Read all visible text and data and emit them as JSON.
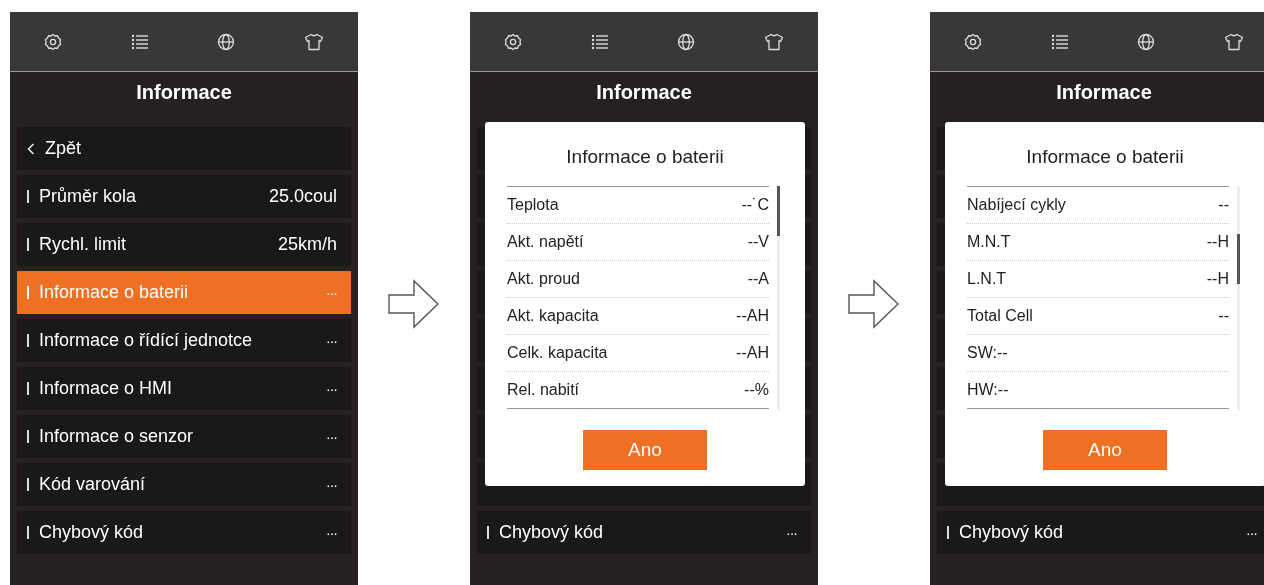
{
  "screens": [
    {
      "title": "Informace",
      "back": "Zpět",
      "items": [
        {
          "label": "Průměr kola",
          "value": "25.0coul",
          "selected": false
        },
        {
          "label": "Rychl. limit",
          "value": "25km/h",
          "selected": false
        },
        {
          "label": "Informace o baterii",
          "value": "···",
          "selected": true
        },
        {
          "label": "Informace o řídící jednotce",
          "value": "···",
          "selected": false
        },
        {
          "label": "Informace o HMI",
          "value": "···",
          "selected": false
        },
        {
          "label": "Informace o senzor",
          "value": "···",
          "selected": false
        },
        {
          "label": "Kód varování",
          "value": "···",
          "selected": false
        },
        {
          "label": "Chybový kód",
          "value": "···",
          "selected": false
        }
      ]
    },
    {
      "title": "Informace",
      "items": [
        {
          "label": "Chybový kód",
          "value": "···",
          "selected": false
        }
      ],
      "dialog": {
        "title": "Informace o baterii",
        "scrolled": false,
        "button": "Ano",
        "rows": [
          {
            "label": "Teplota",
            "value": "--˙C"
          },
          {
            "label": "Akt. napětí",
            "value": "--V"
          },
          {
            "label": "Akt. proud",
            "value": "--A"
          },
          {
            "label": "Akt. kapacita",
            "value": "--AH"
          },
          {
            "label": "Celk. kapacita",
            "value": "--AH"
          },
          {
            "label": "Rel. nabití",
            "value": "--%"
          }
        ]
      }
    },
    {
      "title": "Informace",
      "items": [
        {
          "label": "Chybový kód",
          "value": "···",
          "selected": false
        }
      ],
      "dialog": {
        "title": "Informace o baterii",
        "scrolled": true,
        "button": "Ano",
        "rows": [
          {
            "label": "Nabíjecí cykly",
            "value": "--"
          },
          {
            "label": "M.N.T",
            "value": "--H"
          },
          {
            "label": "L.N.T",
            "value": "--H"
          },
          {
            "label": "Total Cell",
            "value": "--"
          },
          {
            "label": "SW:--"
          },
          {
            "label": "HW:--"
          }
        ]
      }
    }
  ]
}
